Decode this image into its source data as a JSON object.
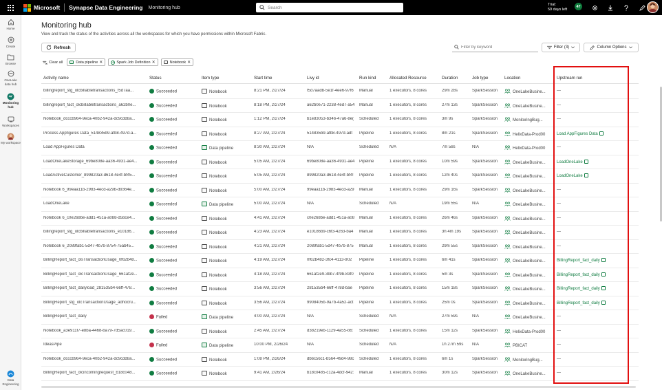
{
  "topbar": {
    "brand": "Microsoft",
    "product": "Synapse Data Engineering",
    "breadcrumb": "Monitoring hub",
    "search_placeholder": "Search",
    "trial_line1": "Trial:",
    "trial_line2": "59 days left",
    "notification_count": "47"
  },
  "rail": {
    "items": [
      {
        "label": "Home",
        "icon": "home-icon"
      },
      {
        "label": "Create",
        "icon": "plus-icon"
      },
      {
        "label": "Browse",
        "icon": "folder-icon"
      },
      {
        "label": "OneLake data hub",
        "icon": "onelake-icon"
      },
      {
        "label": "Monitoring hub",
        "icon": "monitor-icon"
      },
      {
        "label": "Workspaces",
        "icon": "workspaces-icon"
      },
      {
        "label": "My workspace",
        "icon": "avatar-icon"
      }
    ],
    "footer_label": "Data Engineering"
  },
  "page": {
    "title": "Monitoring hub",
    "description": "View and track the status of the activities across all the workspaces for which you have permissions within Microsoft Fabric."
  },
  "toolbar": {
    "refresh_label": "Refresh",
    "filter_placeholder": "Filter by keyword",
    "filter_label": "Filter (3)",
    "column_options_label": "Column Options"
  },
  "chips": {
    "clear_all": "Clear all",
    "items": [
      "Data pipeline",
      "Spark Job Definition",
      "Notebook"
    ]
  },
  "table": {
    "columns": [
      "Activity name",
      "Status",
      "Item type",
      "Start time",
      "Livy id",
      "Run kind",
      "Allocated Resource",
      "Duration",
      "Job type",
      "Location",
      "Upstream run"
    ],
    "rows": [
      {
        "name": "billingreport_stg_olcbillabletransactions_f5d7aa...",
        "status": "Succeeded",
        "type": "Notebook",
        "start": "8:21 PM, 2/27/24",
        "livy": "f5d7aadb-5e1f-4ee6-97f6",
        "kind": "Manual",
        "res": "1 executors, 8 cores",
        "dur": "29m 28s",
        "job": "SparkSession",
        "loc": "OneLakeBusine...",
        "up": "—"
      },
      {
        "name": "billingreport_fact_olcbillabletransactions_a62b0e...",
        "status": "Succeeded",
        "type": "Notebook",
        "start": "8:18 PM, 2/27/24",
        "livy": "a62b0e71-2238-4ed7-a54",
        "kind": "Manual",
        "res": "1 executors, 8 cores",
        "dur": "27m 13s",
        "job": "SparkSession",
        "loc": "OneLakeBusine...",
        "up": "—"
      },
      {
        "name": "Notebook_dcccb964-9eca-40b2-942a-dc9cdd8a...",
        "status": "Succeeded",
        "type": "Notebook",
        "start": "1:12 PM, 2/27/24",
        "livy": "b1e83053-b346-47a6-8e(",
        "kind": "Scheduled",
        "res": "1 executors, 8 cores",
        "dur": "3m 9s",
        "job": "SparkSession",
        "loc": "MonitoringBug...",
        "up": "—"
      },
      {
        "name": "Process Appfigures Data_514835b9-afb8-497d-a...",
        "status": "Succeeded",
        "type": "Notebook",
        "start": "8:27 AM, 2/27/24",
        "livy": "514835b9-afb8-497d-adt",
        "kind": "Pipeline",
        "res": "1 executors, 8 cores",
        "dur": "8m 21s",
        "job": "SparkSession",
        "loc": "HelixData-Prod00",
        "up": "Load AppFigures Data"
      },
      {
        "name": "Load AppFigures Data",
        "status": "Succeeded",
        "type": "Data pipeline",
        "start": "8:30 AM, 2/27/24",
        "livy": "N/A",
        "kind": "Scheduled",
        "res": "N/A",
        "dur": "7m 58s",
        "job": "N/A",
        "loc": "HelixData-Prod00",
        "up": "—"
      },
      {
        "name": "LoadOneLakeStorage_69be808e-aa36-4931-ae4...",
        "status": "Succeeded",
        "type": "Notebook",
        "start": "5:05 AM, 2/27/24",
        "livy": "69be808e-aa36-4931-ae4",
        "kind": "Pipeline",
        "res": "1 executors, 8 cores",
        "dur": "10m 59s",
        "job": "SparkSession",
        "loc": "OneLakeBusine...",
        "up": "LoadOneLake"
      },
      {
        "name": "LoadActiveCustomer_899820a3-d618-4e4f-bf45...",
        "status": "Succeeded",
        "type": "Notebook",
        "start": "5:05 AM, 2/27/24",
        "livy": "899820a3-d618-4e4f-bf4!",
        "kind": "Pipeline",
        "res": "1 executors, 8 cores",
        "dur": "12m 40s",
        "job": "SparkSession",
        "loc": "OneLakeBusine...",
        "up": "LoadOneLake"
      },
      {
        "name": "Notebook 6_99eaa11b-2983-4ecd-a29b-d9364e...",
        "status": "Succeeded",
        "type": "Notebook",
        "start": "5:00 AM, 2/27/24",
        "livy": "99eaa11b-2983-4ecd-a29",
        "kind": "Manual",
        "res": "1 executors, 8 cores",
        "dur": "29m 16s",
        "job": "SparkSession",
        "loc": "OneLakeBusine...",
        "up": "—"
      },
      {
        "name": "LoadOneLake",
        "status": "Succeeded",
        "type": "Data pipeline",
        "start": "5:00 AM, 2/27/24",
        "livy": "N/A",
        "kind": "Scheduled",
        "res": "N/A",
        "dur": "19m 55s",
        "job": "N/A",
        "loc": "OneLakeBusine...",
        "up": "—"
      },
      {
        "name": "Notebook 6_c0e268be-add1-451a-a088-d5bce4...",
        "status": "Succeeded",
        "type": "Notebook",
        "start": "4:41 AM, 2/27/24",
        "livy": "c0e268be-add1-451a-a08",
        "kind": "Manual",
        "res": "1 executors, 8 cores",
        "dur": "26m 46s",
        "job": "SparkSession",
        "loc": "OneLakeBusine...",
        "up": "—"
      },
      {
        "name": "billingreport_stg_olcbillabletransactions_e10186...",
        "status": "Succeeded",
        "type": "Notebook",
        "start": "4:23 AM, 2/27/24",
        "livy": "e10186b9-c6f3-4263-ba4",
        "kind": "Manual",
        "res": "1 executors, 8 cores",
        "dur": "3h 4m 19s",
        "job": "SparkSession",
        "loc": "OneLakeBusine...",
        "up": "—"
      },
      {
        "name": "Notebook 6_2089fab1-5d47-4b7b-8754-75ab45...",
        "status": "Succeeded",
        "type": "Notebook",
        "start": "4:21 AM, 2/27/24",
        "livy": "2089fab1-5d47-4b7b-875",
        "kind": "Manual",
        "res": "1 executors, 8 cores",
        "dur": "29m 55s",
        "job": "SparkSession",
        "loc": "OneLakeBusine...",
        "up": "—"
      },
      {
        "name": "BillingReport_fact_olsTransactionUsage_0f62b48...",
        "status": "Succeeded",
        "type": "Notebook",
        "start": "4:19 AM, 2/27/24",
        "livy": "0f62b482-3fc4-4113-902",
        "kind": "Pipeline",
        "res": "1 executors, 8 cores",
        "dur": "6m 41s",
        "job": "SparkSession",
        "loc": "OneLakeBusine...",
        "up": "BillingReport_fact_daily"
      },
      {
        "name": "BillingReport_fact_olcTransactionUsage_661af2e...",
        "status": "Succeeded",
        "type": "Notebook",
        "start": "4:18 AM, 2/27/24",
        "livy": "661af2e9-3bb7-4f9b-83f0",
        "kind": "Pipeline",
        "res": "1 executors, 8 cores",
        "dur": "5m 3s",
        "job": "SparkSession",
        "loc": "OneLakeBusine...",
        "up": "BillingReport_fact_daily"
      },
      {
        "name": "BillingReport_fact_dailyload_281535b4-66ff-478...",
        "status": "Succeeded",
        "type": "Notebook",
        "start": "3:56 AM, 2/27/24",
        "livy": "281535b4-66ff-478d-bae",
        "kind": "Pipeline",
        "res": "1 executors, 8 cores",
        "dur": "15m 18s",
        "job": "SparkSession",
        "loc": "OneLakeBusine...",
        "up": "BillingReport_fact_daily"
      },
      {
        "name": "BillingReport_stg_olcTransactionUsage_adhocru...",
        "status": "Succeeded",
        "type": "Notebook",
        "start": "3:56 AM, 2/27/24",
        "livy": "9908405b-9a7b-4a52-act",
        "kind": "Pipeline",
        "res": "1 executors, 8 cores",
        "dur": "25m 0s",
        "job": "SparkSession",
        "loc": "OneLakeBusine...",
        "up": "BillingReport_fact_daily"
      },
      {
        "name": "BillingReport_fact_daily",
        "status": "Failed",
        "type": "Data pipeline",
        "start": "4:00 AM, 2/27/24",
        "livy": "N/A",
        "kind": "Scheduled",
        "res": "N/A",
        "dur": "27m 59s",
        "job": "N/A",
        "loc": "OneLakeBusine...",
        "up": "—"
      },
      {
        "name": "Notebook_a3e911f7-e8ba-4468-ba79-7d5ac019...",
        "status": "Succeeded",
        "type": "Notebook",
        "start": "2:45 AM, 2/27/24",
        "livy": "d38219eb-1129-4a55-b6:",
        "kind": "Scheduled",
        "res": "1 executors, 8 cores",
        "dur": "15m 12s",
        "job": "SparkSession",
        "loc": "HelixData-Prod00",
        "up": "—"
      },
      {
        "name": "IdeasPipe",
        "status": "Failed",
        "type": "Data pipeline",
        "start": "10:00 PM, 2/26/24",
        "livy": "N/A",
        "kind": "Scheduled",
        "res": "N/A",
        "dur": "1h 27m 59s",
        "job": "N/A",
        "loc": "PBICAT",
        "up": "—"
      },
      {
        "name": "Notebook_dcccb964-9eca-40b2-942a-dc9cdd8a...",
        "status": "Succeeded",
        "type": "Notebook",
        "start": "1:08 PM, 2/26/24",
        "livy": "db6c56c1-b564-49d4-98c",
        "kind": "Scheduled",
        "res": "1 executors, 8 cores",
        "dur": "6m 1s",
        "job": "SparkSession",
        "loc": "MonitoringBug...",
        "up": "—"
      },
      {
        "name": "BillingReport_fact_olcincomingrequest_b18c048...",
        "status": "Succeeded",
        "type": "Notebook",
        "start": "9:41 AM, 2/26/24",
        "livy": "b18c0485-c12a-4dcf-942:",
        "kind": "Manual",
        "res": "1 executors, 8 cores",
        "dur": "30m 12s",
        "job": "SparkSession",
        "loc": "OneLakeBusine...",
        "up": "—"
      }
    ]
  },
  "colors": {
    "accent": "#107c41",
    "failed": "#c4314b",
    "highlight": "#e20f0f"
  }
}
